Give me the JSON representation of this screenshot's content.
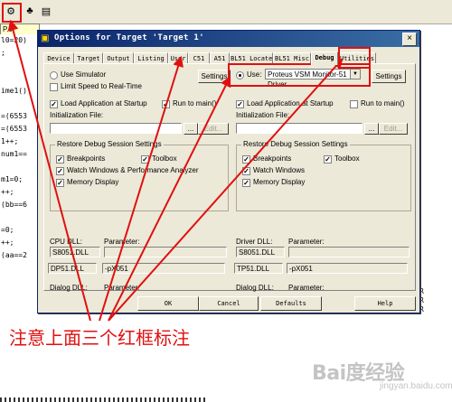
{
  "ide": {
    "file_tab": "P.c",
    "code_lines": [
      "l0=20)",
      ";",
      "",
      "",
      "ime1()",
      "",
      "=(6553",
      "=(6553",
      "1++;",
      "num1==",
      "",
      "m1=0;",
      "++;",
      "(bb==6",
      "",
      "=0;",
      "++;",
      "(aa==2"
    ],
    "right_strip": [
      "R",
      "R",
      "R"
    ]
  },
  "dialog": {
    "title": "Options for Target 'Target 1'",
    "close_symbol": "×",
    "tabs": [
      "Device",
      "Target",
      "Output",
      "Listing",
      "User",
      "C51",
      "A51",
      "BL51 Locate",
      "BL51 Misc",
      "Debug",
      "Utilities"
    ],
    "active_tab": "Debug",
    "left": {
      "use_simulator": "Use Simulator",
      "limit_speed": "Limit Speed to Real-Time",
      "settings": "Settings",
      "load_app": "Load Application at Startup",
      "run_to_main": "Run to main()",
      "init_file_label": "Initialization File:",
      "browse": "...",
      "edit": "Edit...",
      "restore_title": "Restore Debug Session Settings",
      "breakpoints": "Breakpoints",
      "toolbox": "Toolbox",
      "watch_windows": "Watch Windows & Performance Analyzer",
      "memory_display": "Memory Display",
      "dll_label": "CPU DLL:",
      "dll_value": "S8051.DLL",
      "dll_param_label": "Parameter:",
      "dll_param_value": "",
      "dialog_dll_label": "Dialog DLL:",
      "dialog_dll_value": "DP51.DLL",
      "dialog_param_label": "Parameter:",
      "dialog_param_value": "-pX051"
    },
    "right": {
      "use": "Use:",
      "driver": "Proteus VSM Monitor-51 Driver",
      "settings": "Settings",
      "load_app": "Load Application at Startup",
      "run_to_main": "Run to main()",
      "init_file_label": "Initialization File:",
      "browse": "...",
      "edit": "Edit...",
      "restore_title": "Restore Debug Session Settings",
      "breakpoints": "Breakpoints",
      "toolbox": "Toolbox",
      "watch_windows": "Watch Windows",
      "memory_display": "Memory Display",
      "dll_label": "Driver DLL:",
      "dll_value": "S8051.DLL",
      "dll_param_label": "Parameter:",
      "dll_param_value": "",
      "dialog_dll_label": "Dialog DLL:",
      "dialog_dll_value": "TP51.DLL",
      "dialog_param_label": "Parameter:",
      "dialog_param_value": "-pX051"
    },
    "buttons": {
      "ok": "OK",
      "cancel": "Cancel",
      "defaults": "Defaults",
      "help": "Help"
    }
  },
  "annotation": "注意上面三个红框标注",
  "watermark": "Bai度经验",
  "watermark_sub": "jingyan.baidu.com",
  "colors": {
    "annotation": "#e01010",
    "title_bar": "#0a246a",
    "dialog_bg": "#ece9d8"
  }
}
